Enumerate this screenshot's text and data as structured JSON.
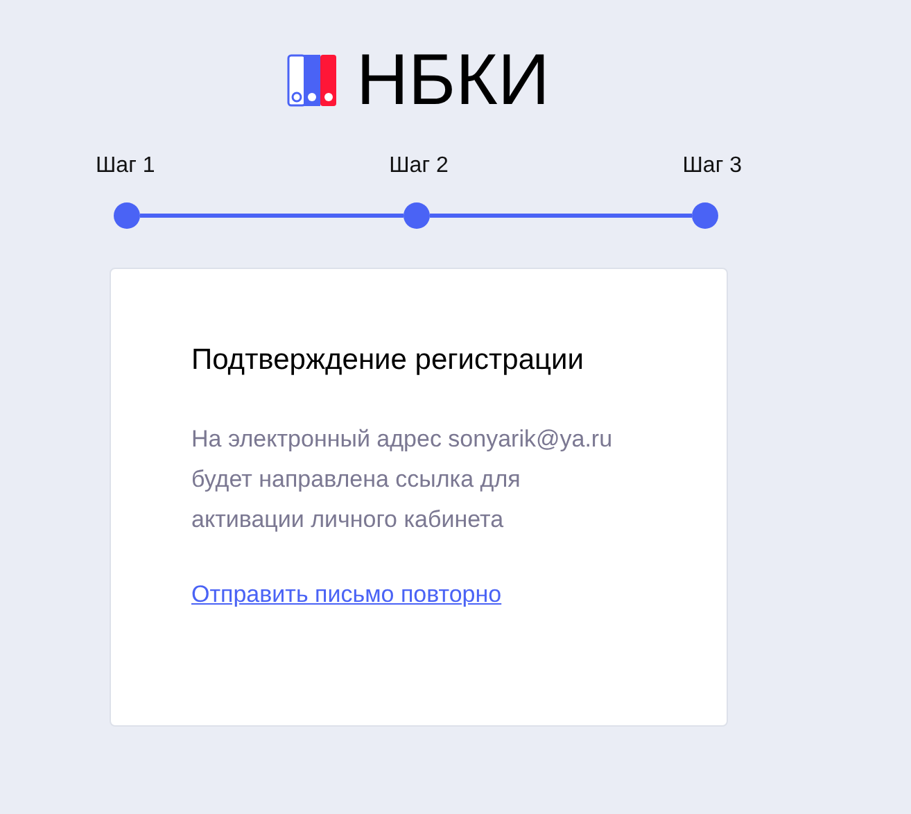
{
  "logo": {
    "text": "НБКИ"
  },
  "steps": [
    {
      "label": "Шаг 1"
    },
    {
      "label": "Шаг 2"
    },
    {
      "label": "Шаг 3"
    }
  ],
  "card": {
    "title": "Подтверждение регистрации",
    "message_lines": [
      "На электронный адрес sonyarik@ya.ru",
      "будет направлена ссылка для",
      "активации личного кабинета"
    ],
    "link": "Отправить письмо повторно"
  }
}
